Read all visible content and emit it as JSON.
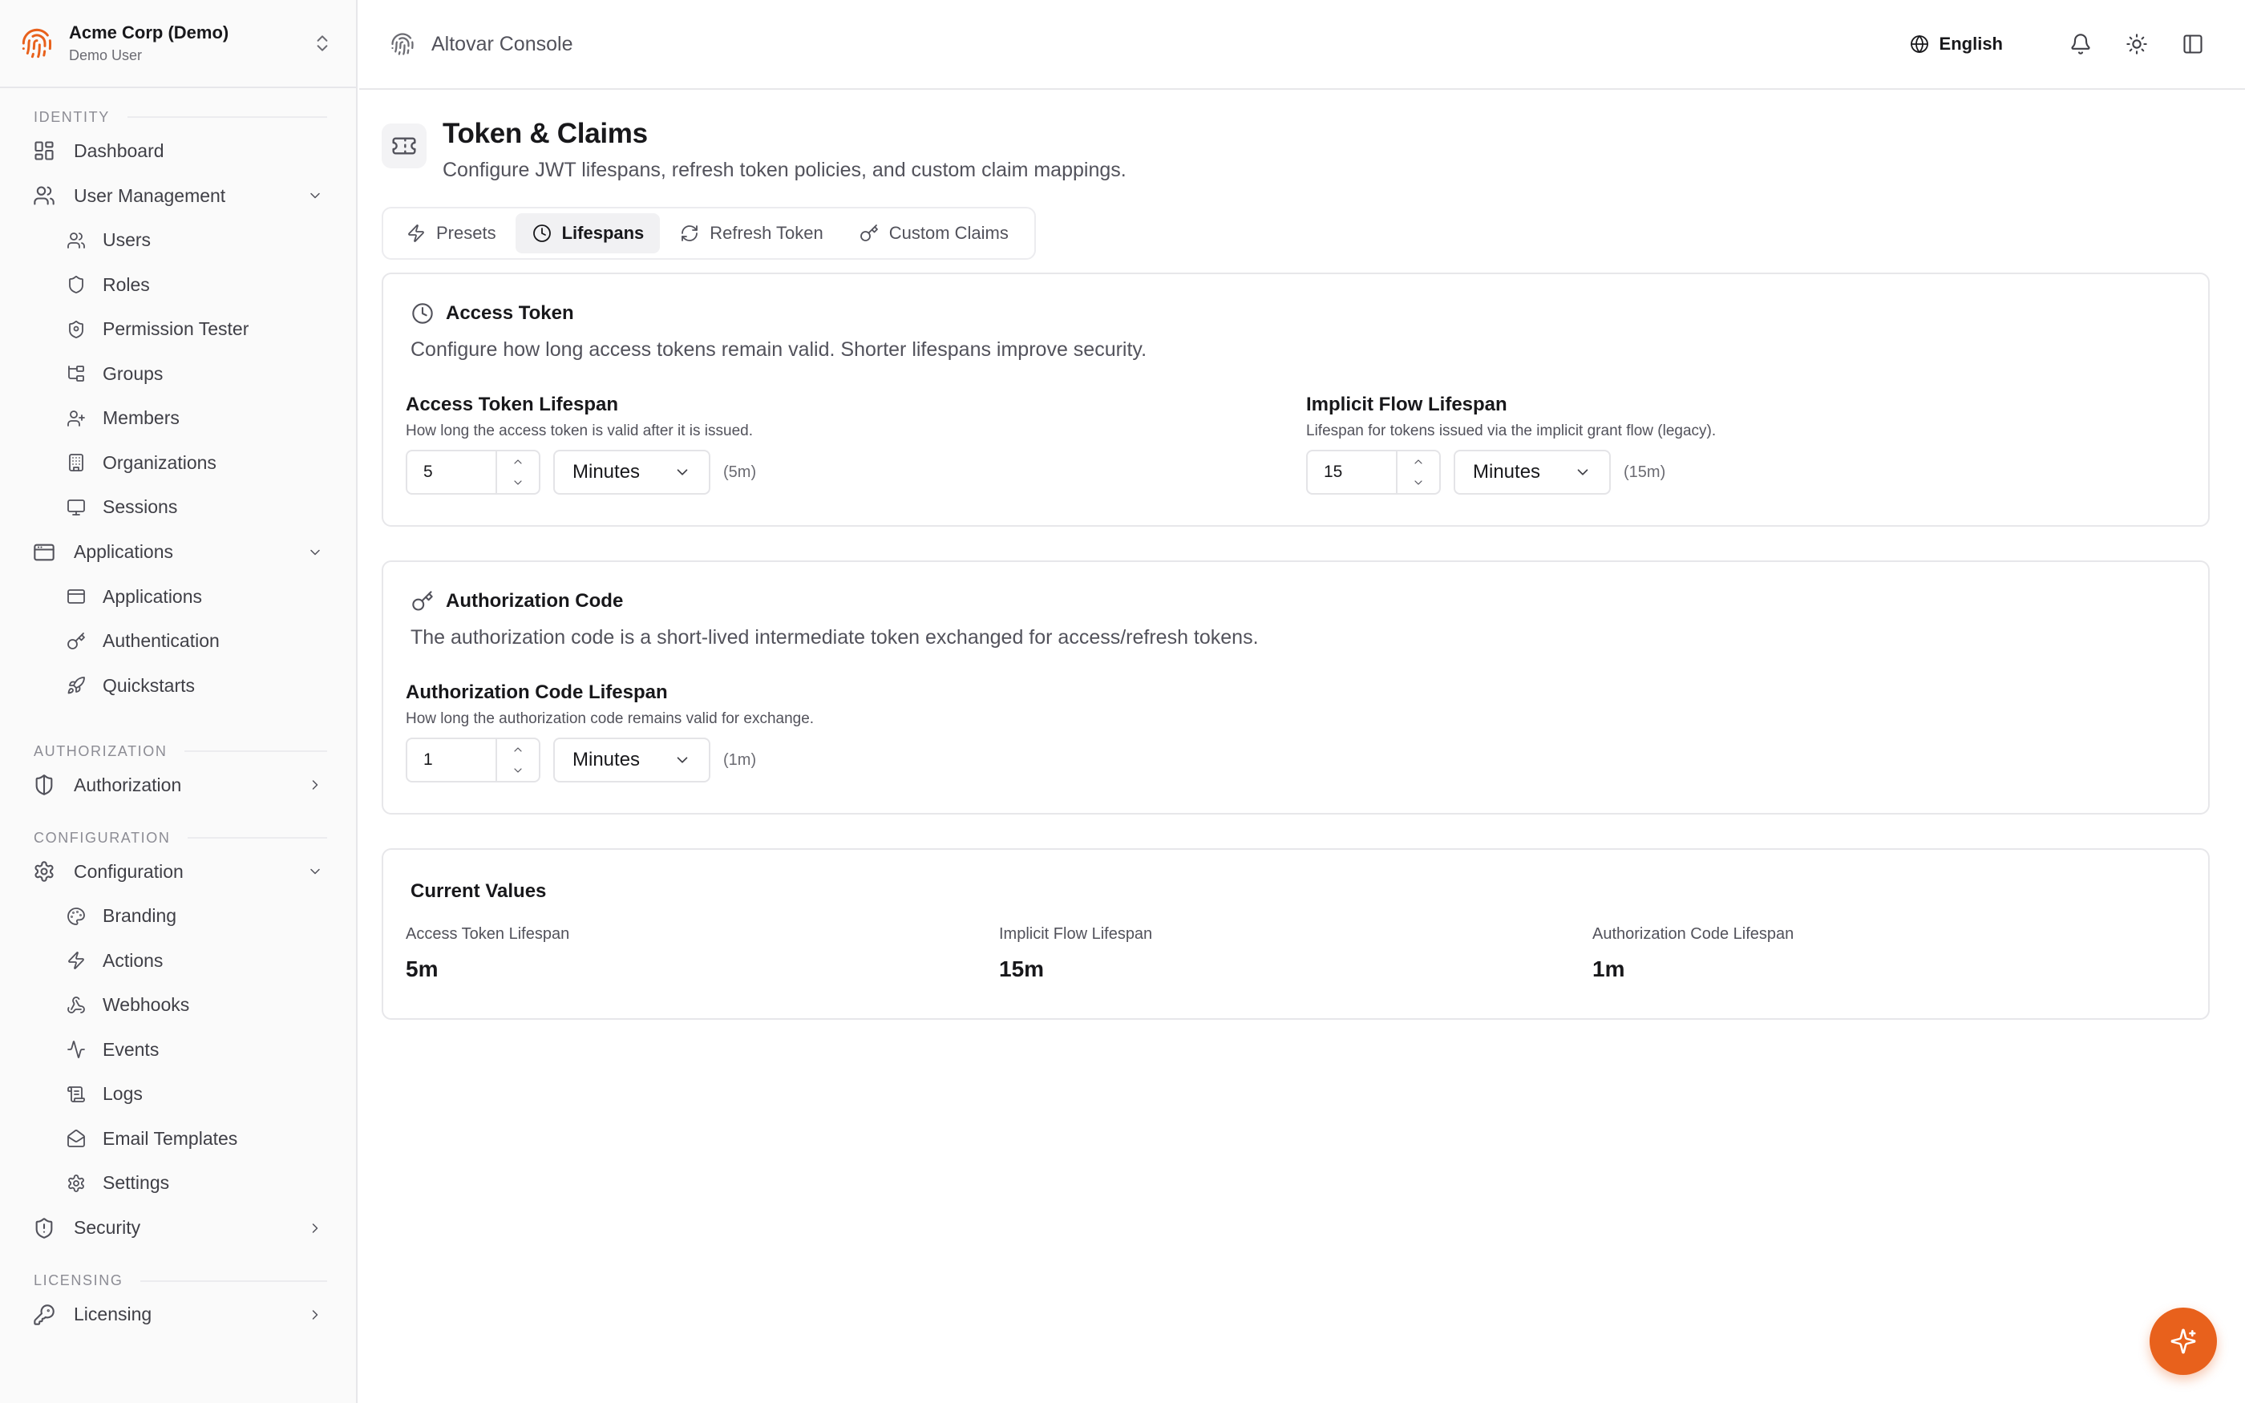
{
  "org": {
    "name": "Acme Corp (Demo)",
    "user": "Demo User"
  },
  "sidebar": {
    "identity_label": "IDENTITY",
    "dashboard": "Dashboard",
    "user_management": "User Management",
    "user_items": [
      "Users",
      "Roles",
      "Permission Tester",
      "Groups",
      "Members",
      "Organizations",
      "Sessions"
    ],
    "applications_group": "Applications",
    "application_items": [
      "Applications",
      "Authentication",
      "Quickstarts"
    ],
    "authorization_label": "AUTHORIZATION",
    "authorization": "Authorization",
    "configuration_label": "CONFIGURATION",
    "configuration": "Configuration",
    "configuration_items": [
      "Branding",
      "Actions",
      "Webhooks",
      "Events",
      "Logs",
      "Email Templates",
      "Settings"
    ],
    "security": "Security",
    "licensing_label": "LICENSING",
    "licensing": "Licensing"
  },
  "header": {
    "title": "Altovar Console",
    "language": "English"
  },
  "page": {
    "title": "Token & Claims",
    "subtitle": "Configure JWT lifespans, refresh token policies, and custom claim mappings."
  },
  "tabs": [
    "Presets",
    "Lifespans",
    "Refresh Token",
    "Custom Claims"
  ],
  "active_tab": "Lifespans",
  "access_token": {
    "title": "Access Token",
    "description": "Configure how long access tokens remain valid. Shorter lifespans improve security.",
    "lifespan": {
      "label": "Access Token Lifespan",
      "help": "How long the access token is valid after it is issued.",
      "value": "5",
      "unit": "Minutes",
      "hint": "(5m)"
    },
    "implicit": {
      "label": "Implicit Flow Lifespan",
      "help": "Lifespan for tokens issued via the implicit grant flow (legacy).",
      "value": "15",
      "unit": "Minutes",
      "hint": "(15m)"
    }
  },
  "auth_code": {
    "title": "Authorization Code",
    "description": "The authorization code is a short-lived intermediate token exchanged for access/refresh tokens.",
    "lifespan": {
      "label": "Authorization Code Lifespan",
      "help": "How long the authorization code remains valid for exchange.",
      "value": "1",
      "unit": "Minutes",
      "hint": "(1m)"
    }
  },
  "current_values": {
    "title": "Current Values",
    "items": [
      {
        "label": "Access Token Lifespan",
        "value": "5m"
      },
      {
        "label": "Implicit Flow Lifespan",
        "value": "15m"
      },
      {
        "label": "Authorization Code Lifespan",
        "value": "1m"
      }
    ]
  },
  "colors": {
    "accent": "#e8611c",
    "border": "#e7e7ea",
    "muted_text": "#52525b"
  }
}
